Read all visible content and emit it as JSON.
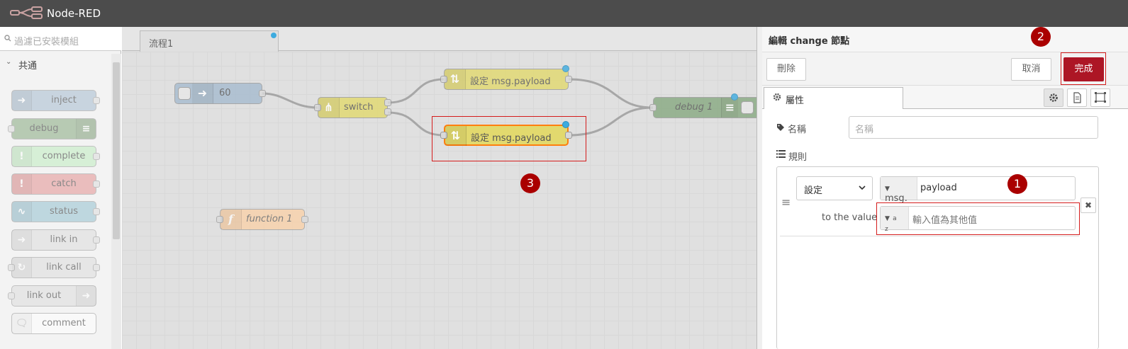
{
  "app": {
    "title": "Node-RED"
  },
  "palette": {
    "search_placeholder": "過濾已安裝模組",
    "category": "共通",
    "nodes": [
      {
        "label": "inject",
        "color": "#a6bbcf"
      },
      {
        "label": "debug",
        "color": "#87a980"
      },
      {
        "label": "complete",
        "color": "#c0edc0"
      },
      {
        "label": "catch",
        "color": "#e49191"
      },
      {
        "label": "status",
        "color": "#94c1d0"
      },
      {
        "label": "link in",
        "color": "#dddddd"
      },
      {
        "label": "link call",
        "color": "#dddddd"
      },
      {
        "label": "link out",
        "color": "#dddddd"
      },
      {
        "label": "comment",
        "color": "#ffffff"
      }
    ]
  },
  "workspace": {
    "tab": "流程1",
    "nodes": {
      "inject": "60",
      "switch": "switch",
      "change1": "設定 msg.payload",
      "change2": "設定 msg.payload",
      "debug": "debug 1",
      "function": "function 1"
    },
    "colors": {
      "change": "#e2d96e",
      "switch": "#e2d96e",
      "inject": "#a6bbcf",
      "debug": "#87a980",
      "function": "#fdd0a2"
    }
  },
  "badges": {
    "one": "1",
    "two": "2",
    "three": "3"
  },
  "editor": {
    "title": "編輯 change 節點",
    "buttons": {
      "delete": "刪除",
      "cancel": "取消",
      "done": "完成"
    },
    "tab_properties": "屬性",
    "name_label": "名稱",
    "name_placeholder": "名稱",
    "rules_label": "規則",
    "rule": {
      "action": "設定",
      "target_type": "msg.",
      "target_value": "payload",
      "to_label": "to the value",
      "value_type": "a z",
      "value_placeholder": "輸入值為其他值"
    }
  }
}
